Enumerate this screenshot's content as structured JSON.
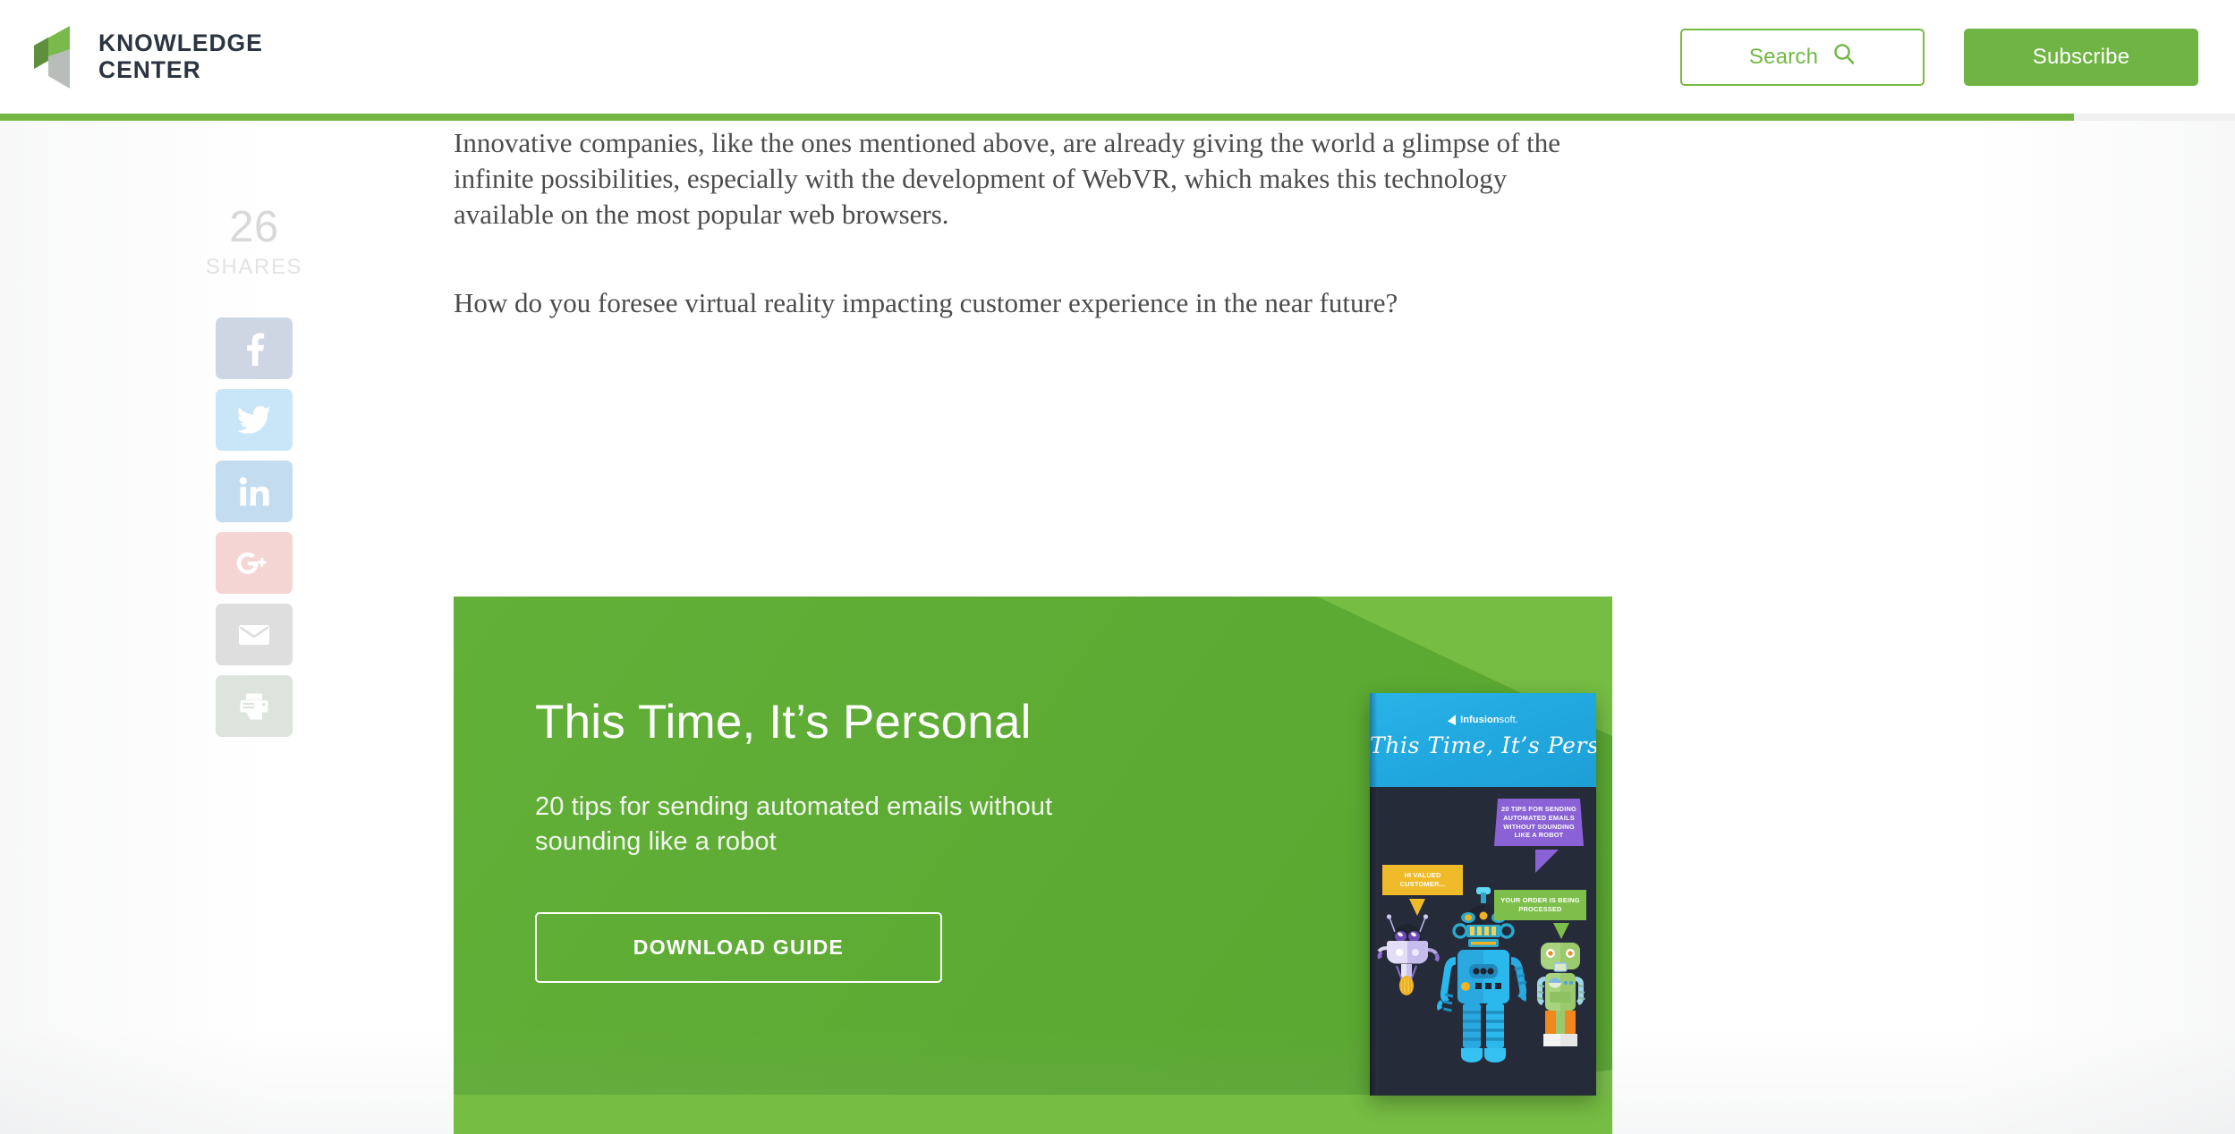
{
  "header": {
    "brand_name": "KNOWLEDGE\nCENTER",
    "search_label": "Search",
    "subscribe_label": "Subscribe",
    "accent_color": "#74b544",
    "brand_text_color": "#2b3440",
    "progress_percent": 92.8
  },
  "share": {
    "count": "26",
    "label": "SHARES",
    "items": [
      {
        "name": "facebook",
        "color": "#ced6e3"
      },
      {
        "name": "twitter",
        "color": "#c9e6f8"
      },
      {
        "name": "linkedin",
        "color": "#c4dcef"
      },
      {
        "name": "googleplus",
        "color": "#f5d5d4"
      },
      {
        "name": "email",
        "color": "#dedede"
      },
      {
        "name": "print",
        "color": "#dde3dd"
      }
    ]
  },
  "article": {
    "paragraph_1": "Innovative companies, like the ones mentioned above, are already giving the world a glimpse of the infinite possibilities, especially with the development of WebVR, which makes this technology available on the most popular web browsers.",
    "paragraph_2": "How do you foresee virtual reality impacting customer experience in the near future?"
  },
  "cta": {
    "title": "This Time, It’s Personal",
    "subtitle": "20 tips for sending automated emails without sounding like a robot",
    "button_label": "DOWNLOAD GUIDE",
    "bg_light": "#76bd43",
    "bg_dark": "#5caa33"
  },
  "ebook": {
    "brand_prefix": "Infusion",
    "brand_suffix": "soft.",
    "cover_title": "This Time, It’s Personal",
    "bubbles": [
      {
        "name": "purple-bubble",
        "text": "20 TIPS FOR SENDING AUTOMATED EMAILS WITHOUT SOUNDING LIKE A ROBOT",
        "color": "#8b62d6"
      },
      {
        "name": "yellow-bubble",
        "text": "HI VALUED CUSTOMER...",
        "color": "#efbb2b"
      },
      {
        "name": "green-bubble",
        "text": "YOUR ORDER IS BEING PROCESSED",
        "color": "#7dbf4a"
      }
    ],
    "top_band_color": "#21a9e0",
    "body_color": "#262b3a"
  }
}
